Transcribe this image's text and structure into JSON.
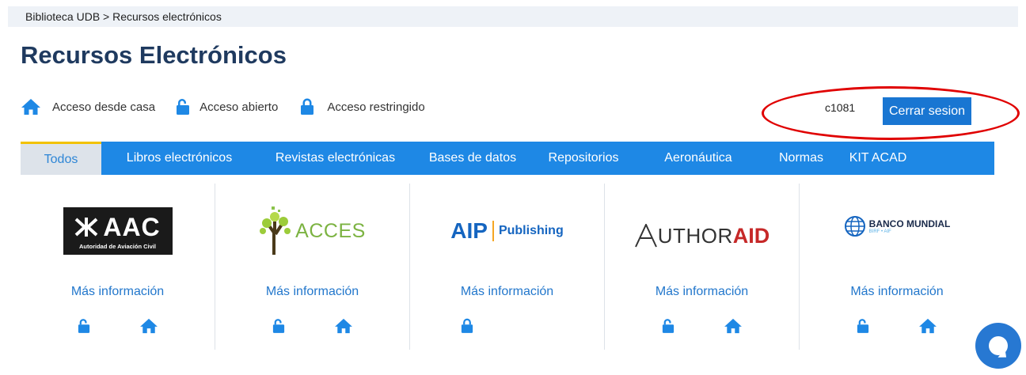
{
  "breadcrumb": "Biblioteca UDB > Recursos electrónicos",
  "page_title": "Recursos Electrónicos",
  "legend": {
    "home": "Acceso desde casa",
    "open": "Acceso abierto",
    "restricted": "Acceso restringido"
  },
  "user": {
    "name": "c1081",
    "logout_label": "Cerrar sesion"
  },
  "tabs": [
    {
      "label": "Todos",
      "active": true
    },
    {
      "label": "Libros electrónicos",
      "active": false
    },
    {
      "label": "Revistas electrónicas",
      "active": false
    },
    {
      "label": "Bases de datos",
      "active": false
    },
    {
      "label": "Repositorios",
      "active": false
    },
    {
      "label": "Aeronáutica",
      "active": false
    },
    {
      "label": "Normas",
      "active": false
    },
    {
      "label": "KIT ACAD",
      "active": false
    }
  ],
  "resources": [
    {
      "logo_main": "AAC",
      "logo_sub": "Autoridad de Aviación Civil",
      "more": "Más información",
      "icons": [
        "open-lock-icon",
        "home-icon"
      ]
    },
    {
      "logo_main": "ACCES",
      "more": "Más información",
      "icons": [
        "open-lock-icon",
        "home-icon"
      ]
    },
    {
      "logo_main": "AIP",
      "logo_sub": "Publishing",
      "more": "Más información",
      "icons": [
        "lock-icon"
      ]
    },
    {
      "logo_main": "UTHOR",
      "logo_sub": "AID",
      "more": "Más información",
      "icons": [
        "open-lock-icon",
        "home-icon"
      ]
    },
    {
      "logo_main": "BANCO MUNDIAL",
      "logo_sub": "BIRF • AIF",
      "more": "Más información",
      "icons": [
        "open-lock-icon",
        "home-icon"
      ]
    }
  ],
  "colors": {
    "accent": "#1e88e5",
    "tab_active_bg": "#dde3ea",
    "tab_active_border": "#f2c200",
    "title": "#1f3a5f",
    "link": "#2277cc",
    "annotation_ring": "#e00000"
  }
}
